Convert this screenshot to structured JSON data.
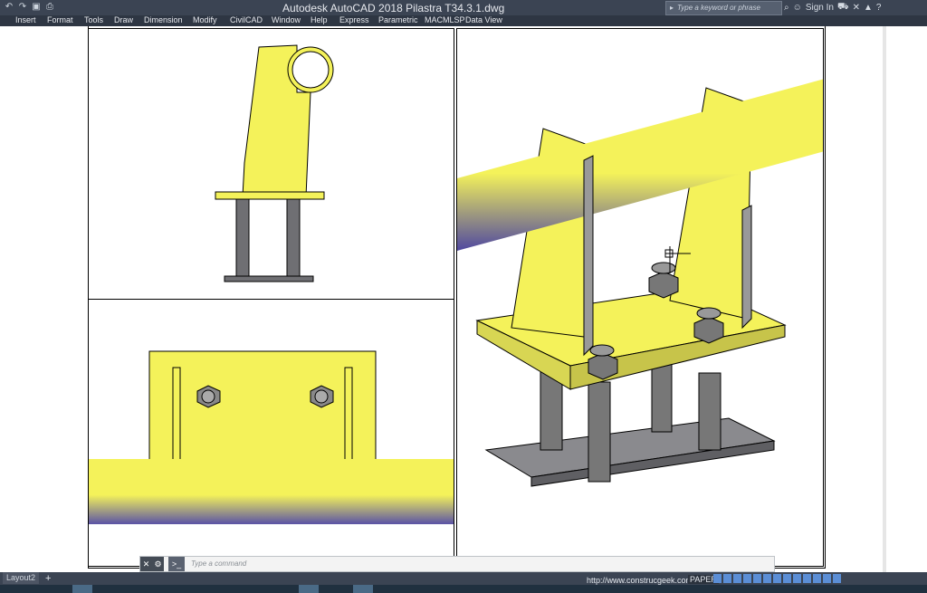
{
  "app": {
    "title": "Autodesk AutoCAD 2018    Pilastra T34.3.1.dwg"
  },
  "search": {
    "placeholder": "Type a keyword or phrase"
  },
  "header": {
    "sign_in": "Sign In"
  },
  "menu": {
    "items": [
      "Insert",
      "Format",
      "Tools",
      "Draw",
      "Dimension",
      "Modify",
      "CivilCAD",
      "Window",
      "Help",
      "Express",
      "Parametric",
      "MACMLSP",
      "Data View"
    ]
  },
  "command": {
    "placeholder": "Type a command"
  },
  "status": {
    "layout_tab": "Layout2",
    "url": "http://www.construcgeek.com/",
    "space": "PAPER"
  },
  "colors": {
    "yellow": "#f4f25a",
    "steel": "#6f6f73",
    "bg": "#ffffff"
  }
}
